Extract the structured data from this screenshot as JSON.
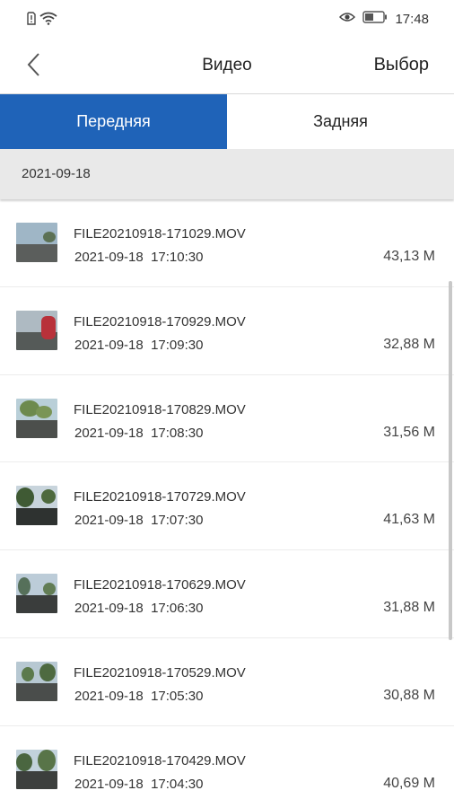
{
  "status_bar": {
    "time": "17:48",
    "left_icons": [
      "sim-alert-icon",
      "wifi-icon"
    ],
    "right_icons": [
      "eye-icon",
      "battery-icon"
    ]
  },
  "header": {
    "title": "Видео",
    "select_label": "Выбор",
    "back_icon": "chevron-left-icon"
  },
  "tabs": [
    {
      "label": "Передняя",
      "active": true
    },
    {
      "label": "Задняя",
      "active": false
    }
  ],
  "date_group": "2021-09-18",
  "files": [
    {
      "name": "FILE20210918-171029.MOV",
      "date": "2021-09-18",
      "time": "17:10:30",
      "size": "43,13 M"
    },
    {
      "name": "FILE20210918-170929.MOV",
      "date": "2021-09-18",
      "time": "17:09:30",
      "size": "32,88 M"
    },
    {
      "name": "FILE20210918-170829.MOV",
      "date": "2021-09-18",
      "time": "17:08:30",
      "size": "31,56 M"
    },
    {
      "name": "FILE20210918-170729.MOV",
      "date": "2021-09-18",
      "time": "17:07:30",
      "size": "41,63 M"
    },
    {
      "name": "FILE20210918-170629.MOV",
      "date": "2021-09-18",
      "time": "17:06:30",
      "size": "31,88 M"
    },
    {
      "name": "FILE20210918-170529.MOV",
      "date": "2021-09-18",
      "time": "17:05:30",
      "size": "30,88 M"
    },
    {
      "name": "FILE20210918-170429.MOV",
      "date": "2021-09-18",
      "time": "17:04:30",
      "size": "40,69 M"
    }
  ],
  "colors": {
    "accent": "#1f63b8",
    "date_header_bg": "#e9e9e9"
  }
}
